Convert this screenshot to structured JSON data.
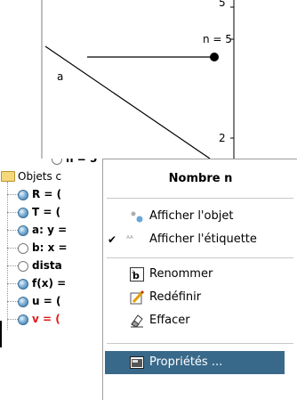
{
  "graphics": {
    "axis_tick_labels": [
      "5",
      "2"
    ],
    "slider_label": "n = 5",
    "segment_label": "a",
    "partial_top_label": "n = 5"
  },
  "algebra": {
    "folder_label": "Objets c",
    "items": [
      {
        "label": "R = (",
        "visible": true,
        "color": "#000000"
      },
      {
        "label": "T = (",
        "visible": true,
        "color": "#000000"
      },
      {
        "label": "a: y =",
        "visible": true,
        "color": "#000000"
      },
      {
        "label": "b: x =",
        "visible": false,
        "color": "#000000"
      },
      {
        "label": "dista",
        "visible": false,
        "color": "#000000"
      },
      {
        "label": "f(x) =",
        "visible": true,
        "color": "#000000"
      },
      {
        "label": "u = (",
        "visible": true,
        "color": "#000000"
      },
      {
        "label": "v = (",
        "visible": true,
        "color": "#e01818"
      }
    ]
  },
  "context_menu": {
    "title": "Nombre n",
    "items": [
      {
        "label": "Afficher l'objet",
        "icon": "show-object-icon",
        "checked": false
      },
      {
        "label": "Afficher l'étiquette",
        "icon": "show-label-icon",
        "checked": true
      },
      {
        "label": "Renommer",
        "icon": "rename-icon",
        "checked": false
      },
      {
        "label": "Redéfinir",
        "icon": "redefine-icon",
        "checked": false
      },
      {
        "label": "Effacer",
        "icon": "eraser-icon",
        "checked": false
      },
      {
        "label": "Propriétés ...",
        "icon": "properties-icon",
        "checked": false,
        "highlighted": true
      }
    ],
    "colors": {
      "highlight": "#39698a",
      "accent_blue": "#2f6f9f"
    }
  }
}
